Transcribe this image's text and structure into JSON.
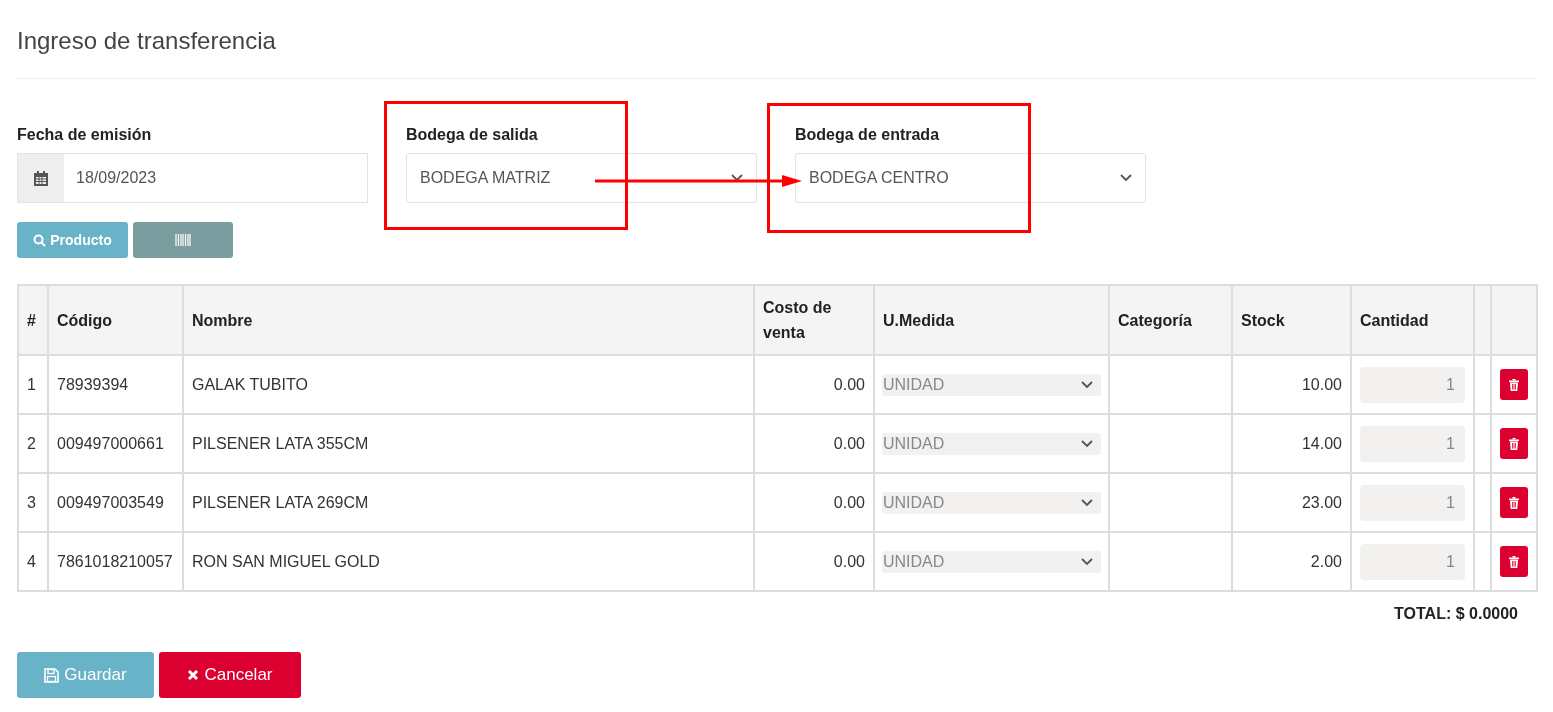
{
  "title": "Ingreso de transferencia",
  "fields": [
    {
      "kind": "date",
      "label": "Fecha de emisión",
      "value": "18/09/2023"
    },
    {
      "kind": "select",
      "label": "Bodega de salida",
      "value": "BODEGA MATRIZ"
    },
    {
      "kind": "select",
      "label": "Bodega de entrada",
      "value": "BODEGA CENTRO"
    }
  ],
  "toolbar": [
    {
      "kind": "search",
      "label": "Producto"
    },
    {
      "kind": "barcode"
    }
  ],
  "table": {
    "columns": [
      "#",
      "Código",
      "Nombre",
      "Costo de venta",
      "U.Medida",
      "Categoría",
      "Stock",
      "Cantidad"
    ],
    "rows": [
      {
        "num": "1",
        "code": "78939394",
        "name": "GALAK TUBITO",
        "cost": "0.00",
        "unit": "UNIDAD",
        "stock": "10.00",
        "quantity": "1"
      },
      {
        "num": "2",
        "code": "009497000661",
        "name": "PILSENER LATA 355CM",
        "cost": "0.00",
        "unit": "UNIDAD",
        "stock": "14.00",
        "quantity": "1"
      },
      {
        "num": "3",
        "code": "009497003549",
        "name": "PILSENER LATA 269CM",
        "cost": "0.00",
        "unit": "UNIDAD",
        "stock": "23.00",
        "quantity": "1"
      },
      {
        "num": "4",
        "code": "7861018210057",
        "name": "RON SAN MIGUEL GOLD",
        "cost": "0.00",
        "unit": "UNIDAD",
        "stock": "2.00",
        "quantity": "1"
      }
    ]
  },
  "total": "TOTAL: $ 0.0000",
  "actions": [
    {
      "kind": "save",
      "label": "Guardar"
    },
    {
      "kind": "cancel",
      "label": "Cancelar"
    }
  ]
}
